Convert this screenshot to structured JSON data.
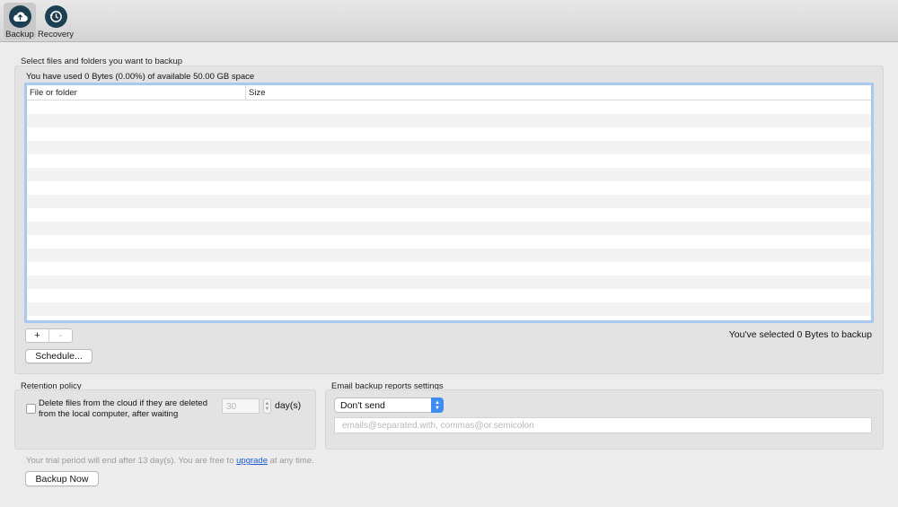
{
  "toolbar": {
    "items": [
      {
        "label": "Backup",
        "icon": "cloud-upload-icon",
        "active": true
      },
      {
        "label": "Recovery",
        "icon": "history-clock-icon",
        "active": false
      }
    ]
  },
  "files": {
    "section_title": "Select files and folders you want to backup",
    "usage_text": "You have used 0 Bytes (0.00%) of available 50.00 GB space",
    "columns": [
      "File or folder",
      "Size"
    ],
    "rows": [],
    "add_label": "+",
    "remove_label": "-",
    "selected_text": "You've selected 0 Bytes to backup",
    "schedule_label": "Schedule..."
  },
  "retention": {
    "title": "Retention policy",
    "checkbox_label": "Delete files from the cloud if they are deleted from the local computer, after waiting",
    "checked": false,
    "days_value": "30",
    "days_unit": "day(s)"
  },
  "email": {
    "title": "Email backup reports settings",
    "selected_option": "Don't send",
    "placeholder": "emails@separated.with, commas@or.semicolon"
  },
  "footer": {
    "trial_text_before": "Your trial period will end after 13 day(s). You are free to ",
    "upgrade_link": "upgrade",
    "trial_text_after": " at any time.",
    "backup_now_label": "Backup Now"
  },
  "colors": {
    "accent": "#3f8cf2",
    "icon_bg": "#1c3f52",
    "table_focus_border": "#a8c9f0",
    "link": "#1a5bd6"
  }
}
